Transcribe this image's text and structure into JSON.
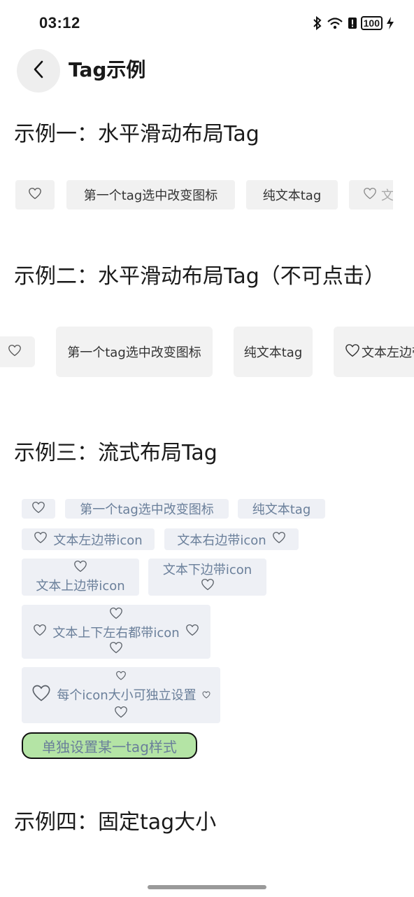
{
  "status_bar": {
    "time": "03:12",
    "battery": "100"
  },
  "header": {
    "title": "Tag示例"
  },
  "sections": {
    "s1": "示例一：水平滑动布局Tag",
    "s2": "示例二：水平滑动布局Tag（不可点击）",
    "s3": "示例三：流式布局Tag",
    "s4": "示例四：固定tag大小"
  },
  "row1": {
    "t2": "第一个tag选中改变图标",
    "t3": "纯文本tag",
    "t4": "文"
  },
  "row2": {
    "t2": "第一个tag选中改变图标",
    "t3": "纯文本tag",
    "t4": "文本左边带"
  },
  "flow": {
    "t2": "第一个tag选中改变图标",
    "t3": "纯文本tag",
    "t4": "文本左边带icon",
    "t5": "文本右边带icon",
    "t6": "文本上边带icon",
    "t7": "文本下边带icon",
    "t8": "文本上下左右都带icon",
    "t9": "每个icon大小可独立设置",
    "t10": "单独设置某一tag样式"
  },
  "colors": {
    "tag_bg": "#f1f1f1",
    "flow_tag_bg": "#eef0f5",
    "flow_text": "#6a7f9a",
    "special_bg": "#b4e4a5"
  },
  "icons": [
    "heart-icon",
    "back-arrow-icon",
    "bluetooth-icon",
    "wifi-icon",
    "battery-icon",
    "charging-icon"
  ]
}
